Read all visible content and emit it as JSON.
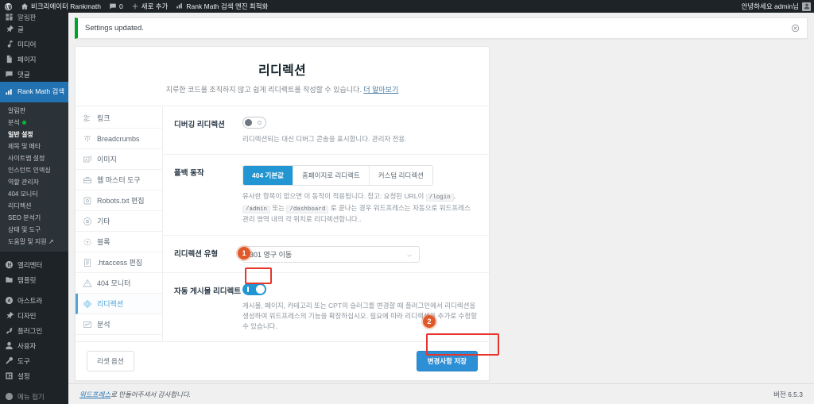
{
  "adminbar": {
    "wp_logo": "wordpress-icon",
    "site_name": "비크리에이터 Rankmath",
    "comments_count": "0",
    "new_label": "새로 추가",
    "rankmath_label": "Rank Math 검색 엔진 최적화",
    "greeting": "안녕하세요 admin님"
  },
  "adminmenu": {
    "clipped_top": "알림판",
    "items": [
      {
        "label": "글",
        "icon": "pin-icon"
      },
      {
        "label": "미디어",
        "icon": "media-icon"
      },
      {
        "label": "페이지",
        "icon": "page-icon"
      },
      {
        "label": "댓글",
        "icon": "comment-icon"
      }
    ],
    "current": {
      "label": "Rank Math 검색 엔진 최적화",
      "icon": "rankmath-icon"
    },
    "submenu": [
      {
        "label": "알림판",
        "active": false,
        "dot": false
      },
      {
        "label": "분석",
        "active": false,
        "dot": true
      },
      {
        "label": "일반 설정",
        "active": true,
        "dot": false
      },
      {
        "label": "제목 및 메타",
        "active": false,
        "dot": false
      },
      {
        "label": "사이트맵 설정",
        "active": false,
        "dot": false
      },
      {
        "label": "인스턴트 인덱싱",
        "active": false,
        "dot": false
      },
      {
        "label": "역할 관리자",
        "active": false,
        "dot": false
      },
      {
        "label": "404 모니터",
        "active": false,
        "dot": false
      },
      {
        "label": "리디렉션",
        "active": false,
        "dot": false
      },
      {
        "label": "SEO 분석기",
        "active": false,
        "dot": false
      },
      {
        "label": "상태 및 도구",
        "active": false,
        "dot": false
      },
      {
        "label": "도움말 및 지원 ↗",
        "active": false,
        "dot": false
      }
    ],
    "items2": [
      {
        "label": "엘리멘터",
        "icon": "elementor-icon"
      },
      {
        "label": "템플릿",
        "icon": "templates-icon"
      }
    ],
    "items3": [
      {
        "label": "아스트라",
        "icon": "astra-icon"
      },
      {
        "label": "디자인",
        "icon": "appearance-icon"
      },
      {
        "label": "플러그인",
        "icon": "plugin-icon"
      },
      {
        "label": "사용자",
        "icon": "users-icon"
      },
      {
        "label": "도구",
        "icon": "tools-icon"
      },
      {
        "label": "설정",
        "icon": "settings-icon"
      }
    ],
    "collapse": {
      "label": "메뉴 접기",
      "icon": "collapse-icon"
    }
  },
  "notice": {
    "text": "Settings updated.",
    "dismiss_icon": "close-circle-icon"
  },
  "panel": {
    "title": "리디렉션",
    "subtitle": "지루한 코드를 조직하지 않고 쉽게 리디렉트를 작성할 수 있습니다.",
    "learn_more": "더 알아보기"
  },
  "tabs": [
    {
      "label": "링크",
      "icon": "link-icon",
      "active": false
    },
    {
      "label": "Breadcrumbs",
      "icon": "breadcrumbs-icon",
      "active": false
    },
    {
      "label": "이미지",
      "icon": "image-icon",
      "active": false
    },
    {
      "label": "웹 마스터 도구",
      "icon": "toolbox-icon",
      "active": false
    },
    {
      "label": "Robots.txt 편집",
      "icon": "robots-icon",
      "active": false
    },
    {
      "label": "기타",
      "icon": "list-icon",
      "active": false
    },
    {
      "label": "블록",
      "icon": "block-icon",
      "active": false
    },
    {
      "label": ".htaccess 편집",
      "icon": "file-icon",
      "active": false
    },
    {
      "label": "404 모니터",
      "icon": "warning-icon",
      "active": false
    },
    {
      "label": "리디렉션",
      "icon": "redirect-icon",
      "active": true
    },
    {
      "label": "분석",
      "icon": "analytics-icon",
      "active": false
    }
  ],
  "fields": {
    "debug": {
      "label": "디버깅 리디렉션",
      "toggle_state": "off",
      "help": "리디렉션되는 대신 디버그 콘솔을 표시합니다. 관리자 전용."
    },
    "fallback": {
      "label": "폴백 동작",
      "options": [
        {
          "label": "404 기본값",
          "active": true
        },
        {
          "label": "홈페이지로 리디렉트",
          "active": false
        },
        {
          "label": "커스텀 리디렉션",
          "active": false
        }
      ],
      "help_part1": "유사한 항목이 없으면 이 동작이 적용됩니다. 참고: 요청된 URL이",
      "code1": "/login",
      "code_sep": ",",
      "code2": "/admin",
      "help_part2": "또는",
      "code3": "/dashboard",
      "help_part3": "로 끝나는 경우 워드프레스는 자동으로 워드프레스 관리 영역 내의 각 위치로 리디렉션합니다.."
    },
    "redirect_type": {
      "label": "리디렉션 유형",
      "value": "301 영구 이동",
      "chevron": "chevron-down-icon"
    },
    "auto_post": {
      "label": "자동 게시물 리디렉트",
      "toggle_state": "on",
      "help": "게시물, 페이지, 카테고리 또는 CPT의 슬러그를 변경할 때 플러그인에서 리디렉션을 생성하여 워드프레스의 기능을 확장하십시오. 필요에 따라 리디렉션을 추가로 수정할 수 있습니다."
    }
  },
  "footer_actions": {
    "reset_label": "리셋 옵션",
    "save_label": "변경사항 저장"
  },
  "markers": [
    {
      "number": "1"
    },
    {
      "number": "2"
    }
  ],
  "pagefooter": {
    "link": "워드프레스",
    "thanks": "로 만들어주셔서 감사합니다.",
    "version": "버전 6.5.3"
  },
  "colors": {
    "accent_blue": "#2196d3",
    "wp_blue": "#2271b1",
    "marker_orange": "#e0592a",
    "highlight_red": "#e8342a",
    "notice_green": "#00a32a"
  }
}
